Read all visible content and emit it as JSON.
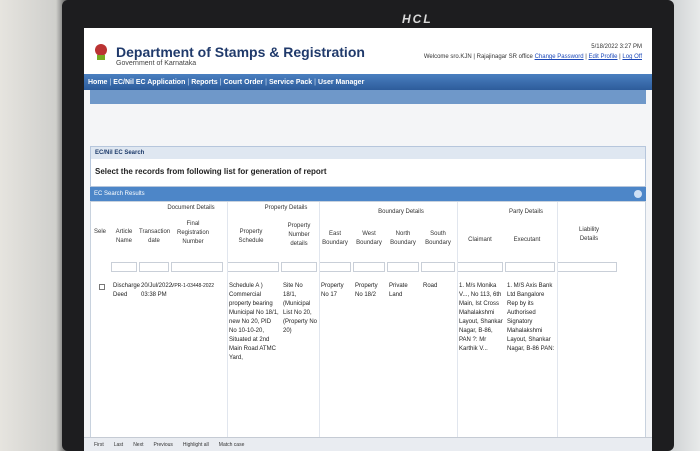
{
  "bezel": {
    "brand": "HCL"
  },
  "header": {
    "dept": "Department of Stamps & Registration",
    "gov": "Government of Karnataka",
    "datetime": "5/18/2022 3:27 PM",
    "welcome": "Welcome sro.KJN | Rajajinagar SR office",
    "links": [
      "Change Password",
      "Edit Profile",
      "Log Off"
    ]
  },
  "nav": [
    "Home",
    "EC/Nil EC Application",
    "Reports",
    "Court Order",
    "Service Pack",
    "User Manager"
  ],
  "search": {
    "title": "EC/Nil EC Search",
    "instruction": "Select the records from following list for generation of report"
  },
  "results": {
    "title": "EC Search Results",
    "groups": [
      "Document Details",
      "Property Details",
      "Boundary Details",
      "Party Details"
    ],
    "columns": [
      "Sele",
      "Article Name",
      "Transaction date",
      "Final Registration Number",
      "Property Schedule",
      "Property Number details",
      "East Boundary",
      "West Boundary",
      "North Boundary",
      "South Boundary",
      "Claimant",
      "Executant",
      "Liability Details"
    ],
    "row": {
      "article": "Discharge Deed",
      "date": "20/Jul/2022 03:38 PM",
      "regno": "VPR-1-03448-2022",
      "schedule": "Schedule A ) Commercial property bearing Municipal No 18/1, new No 20, PID No 10-10-20, Situated at 2nd Main Road ATMC Yard,",
      "property_no": "Site No 18/1, (Municipal List No 20, (Property No 20)",
      "east": "Property No 17",
      "west": "Property No 18/2",
      "north": "Private Land",
      "south": "Road",
      "claimant": "1. M/s Monika V..., No 113, 6th Main, Ist Cross Mahalakshmi Layout, Shankar Nagar, B-86, PAN ?: Mr Karthik V...",
      "executant": "1. M/S Axis Bank Ltd Bangalore Rep by its Authorised Signatory Mahalakshmi Layout, Shankar Nagar, B-86 PAN:"
    }
  },
  "footer": [
    "First",
    "Last",
    "Next",
    "Previous",
    "Highlight all",
    "Match case"
  ]
}
